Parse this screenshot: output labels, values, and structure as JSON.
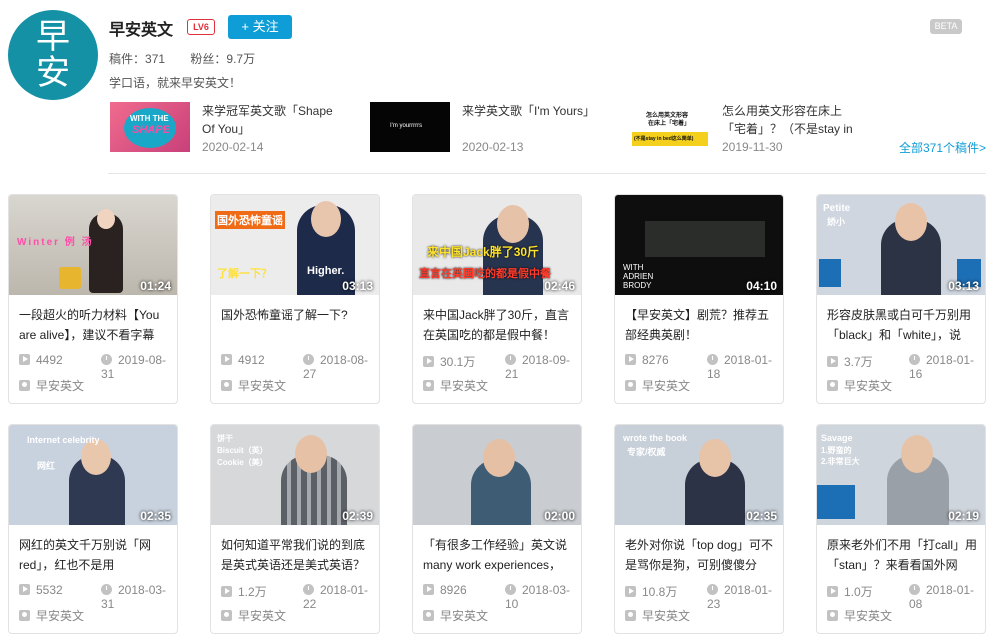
{
  "header": {
    "avatar_text_top": "早",
    "avatar_text_bottom": "安",
    "username": "早安英文",
    "level": "LV6",
    "follow_label": "+ 关注",
    "beta": "BETA",
    "posts_label": "稿件：",
    "posts": "371",
    "fans_label": "粉丝：",
    "fans": "9.7万",
    "bio": "学口语，就来早安英文！",
    "all_link": "全部371个稿件>"
  },
  "recent": [
    {
      "title": "来学冠军英文歌「Shape Of You」",
      "date": "2020-02-14",
      "thumb_text_1": "WITH THE",
      "thumb_text_2": "SHAPE"
    },
    {
      "title": "来学英文歌「I'm Yours」",
      "date": "2020-02-13",
      "thumb_text_1": "I'm yourrrrrs"
    },
    {
      "title": "怎么用英文形容在床上「宅着」？（不是stay in",
      "date": "2019-11-30",
      "thumb_text_1": "怎么用英文形容",
      "thumb_text_2": "在床上「宅着」",
      "thumb_text_3": "(不是stay in bed这么简单)"
    }
  ],
  "videos": [
    {
      "title": "一段超火的听力材料【You are alive】，建议不看字幕",
      "duration": "01:24",
      "views": "4492",
      "date": "2019-08-31",
      "author": "早安英文",
      "overlay": "Winter 例 汤"
    },
    {
      "title": "国外恐怖童谣了解一下?",
      "duration": "03:13",
      "views": "4912",
      "date": "2018-08-27",
      "author": "早安英文",
      "overlay_1": "国外恐怖童谣",
      "overlay_2": "了解一下？",
      "overlay_3": "Higher."
    },
    {
      "title": "来中国Jack胖了30斤，直言在英国吃的都是假中餐！",
      "duration": "02:46",
      "views": "30.1万",
      "date": "2018-09-21",
      "author": "早安英文",
      "overlay_1": "来中国Jack胖了30斤",
      "overlay_2": "直言在英国吃的都是假中餐"
    },
    {
      "title": "【早安英文】剧荒？推荐五部经典英剧！",
      "duration": "04:10",
      "views": "8276",
      "date": "2018-01-18",
      "author": "早安英文",
      "overlay": "WITH ADRIEN BRODY"
    },
    {
      "title": "形容皮肤黑或白可千万别用「black」和「white」，说",
      "duration": "03:13",
      "views": "3.7万",
      "date": "2018-01-16",
      "author": "早安英文",
      "overlay_1": "Petite",
      "overlay_2": "娇小"
    },
    {
      "title": "网红的英文千万别说「网red」，红也不是用",
      "duration": "02:35",
      "views": "5532",
      "date": "2018-03-31",
      "author": "早安英文",
      "overlay_1": "Internet celebrity",
      "overlay_2": "网红"
    },
    {
      "title": "如何知道平常我们说的到底是英式英语还是美式英语？",
      "duration": "02:39",
      "views": "1.2万",
      "date": "2018-01-22",
      "author": "早安英文",
      "overlay_1": "饼干",
      "overlay_2": "Biscuit（英）",
      "overlay_3": "Cookie（美）"
    },
    {
      "title": "「有很多工作经验」英文说many work experiences，",
      "duration": "02:00",
      "views": "8926",
      "date": "2018-03-10",
      "author": "早安英文",
      "overlay": ""
    },
    {
      "title": "老外对你说「top dog」可不是骂你是狗，可别傻傻分",
      "duration": "02:35",
      "views": "10.8万",
      "date": "2018-01-23",
      "author": "早安英文",
      "overlay_1": "wrote the book",
      "overlay_2": "专家/权威"
    },
    {
      "title": "原来老外们不用「打call」用「stan」？来看看国外网",
      "duration": "02:19",
      "views": "1.0万",
      "date": "2018-01-08",
      "author": "早安英文",
      "overlay_1": "Savage",
      "overlay_2": "1.野蛮的",
      "overlay_3": "2.非常巨大"
    }
  ]
}
